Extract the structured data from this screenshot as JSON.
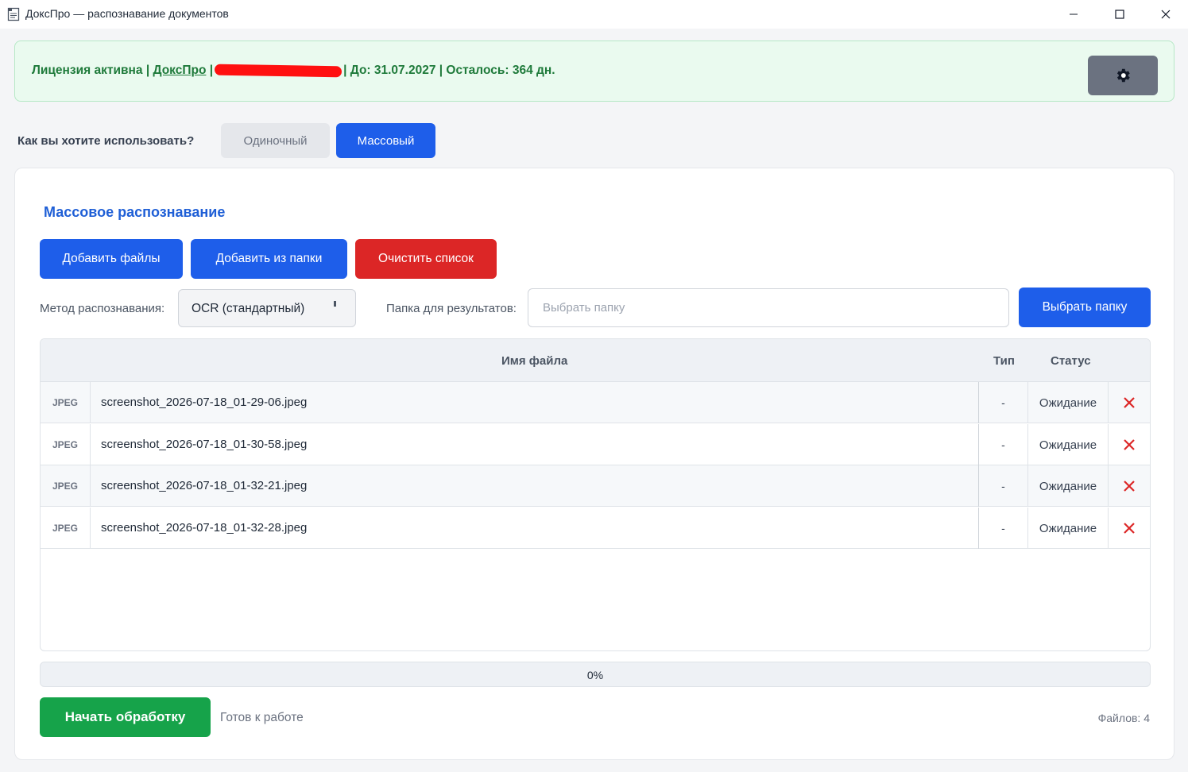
{
  "window": {
    "title": "ДоксПро — распознавание документов",
    "minimize": "—",
    "maximize": "☐",
    "close": "✕"
  },
  "license": {
    "prefix": "Лицензия активна | ",
    "product_link": "ДоксПро",
    "separator": " |",
    "suffix": "| До: 31.07.2027 | Осталось: 364 дн."
  },
  "mode": {
    "question": "Как вы хотите использовать?",
    "single_label": "Одиночный",
    "bulk_label": "Массовый",
    "selected": "Массовый"
  },
  "panel": {
    "title": "Массовое распознавание",
    "add_files": "Добавить файлы",
    "add_folder": "Добавить из папки",
    "clear_list": "Очистить список",
    "method_label": "Метод распознавания:",
    "method_value": "OCR (стандартный)",
    "folder_label": "Папка для результатов:",
    "folder_placeholder": "Выбрать папку",
    "folder_value": "",
    "pick_folder": "Выбрать папку"
  },
  "table": {
    "columns": {
      "name": "Имя файла",
      "type": "Тип",
      "status": "Статус"
    },
    "rows": [
      {
        "badge": "JPEG",
        "name": "screenshot_2026-07-18_01-29-06.jpeg",
        "type": "-",
        "status": "Ожидание"
      },
      {
        "badge": "JPEG",
        "name": "screenshot_2026-07-18_01-30-58.jpeg",
        "type": "-",
        "status": "Ожидание"
      },
      {
        "badge": "JPEG",
        "name": "screenshot_2026-07-18_01-32-21.jpeg",
        "type": "-",
        "status": "Ожидание"
      },
      {
        "badge": "JPEG",
        "name": "screenshot_2026-07-18_01-32-28.jpeg",
        "type": "-",
        "status": "Ожидание"
      }
    ]
  },
  "progress": {
    "value": 0,
    "label": "0%"
  },
  "footer": {
    "start": "Начать обработку",
    "status": "Готов к работе",
    "files_count": "Файлов: 4"
  },
  "colors": {
    "accent": "#1e5eea",
    "danger": "#dc2626",
    "success": "#16a34a",
    "license_bg": "#eafaef",
    "license_text": "#1e7a3a"
  },
  "icons": {
    "app": "document-icon",
    "settings": "gear-icon",
    "delete": "close-icon"
  }
}
